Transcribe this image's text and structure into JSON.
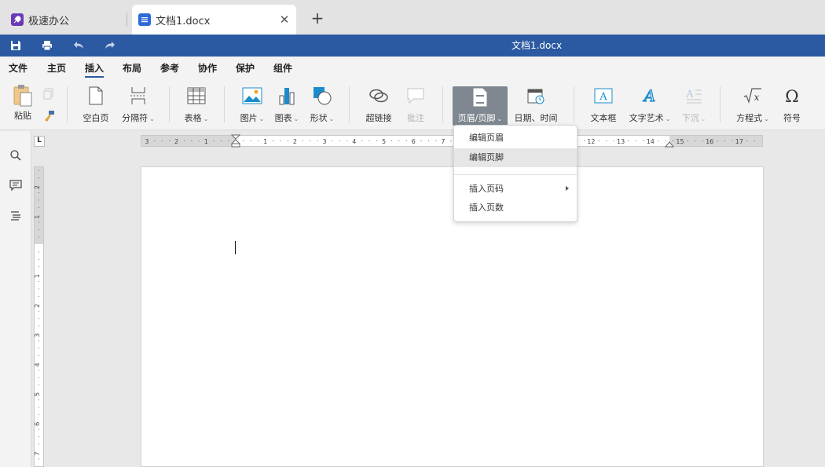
{
  "browser": {
    "tabs": [
      {
        "label": "极速办公"
      },
      {
        "label": "文档1.docx"
      }
    ],
    "new_tab_symbol": "+",
    "close_symbol": "✕"
  },
  "titlebar": {
    "title": "文档1.docx",
    "icons": [
      "save-icon",
      "print-icon",
      "undo-icon",
      "redo-icon"
    ]
  },
  "menu": {
    "items": [
      "文件",
      "主页",
      "插入",
      "布局",
      "参考",
      "协作",
      "保护",
      "组件"
    ],
    "active": "插入"
  },
  "ribbon": {
    "paste": "粘贴",
    "blank_page": "空白页",
    "page_break": "分隔符",
    "table": "表格",
    "picture": "图片",
    "chart": "图表",
    "shape": "形状",
    "hyperlink": "超链接",
    "comment": "批注",
    "header_footer": "页眉/页脚",
    "date_time": "日期、时间",
    "text_box": "文本框",
    "word_art": "文字艺术",
    "drop_cap": "下沉",
    "equation": "方程式",
    "symbol": "符号"
  },
  "header_footer_menu": {
    "items": [
      "编辑页眉",
      "编辑页脚",
      "插入页码",
      "插入页数"
    ],
    "hovered": "编辑页脚"
  },
  "ruler": {
    "corner_label": "L",
    "h_left_numbers": [
      "3",
      "2",
      "1"
    ],
    "h_right_numbers": [
      "1",
      "2",
      "3",
      "4",
      "5",
      "6",
      "7",
      "12",
      "13",
      "14",
      "15",
      "16",
      "17"
    ],
    "v_numbers": [
      "2",
      "1",
      "1",
      "2",
      "3",
      "4",
      "5",
      "6",
      "7"
    ]
  },
  "colors": {
    "accent": "#2b5aa2",
    "selected_ribbon": "#7f8790",
    "wordart": "#1a8ccc"
  }
}
